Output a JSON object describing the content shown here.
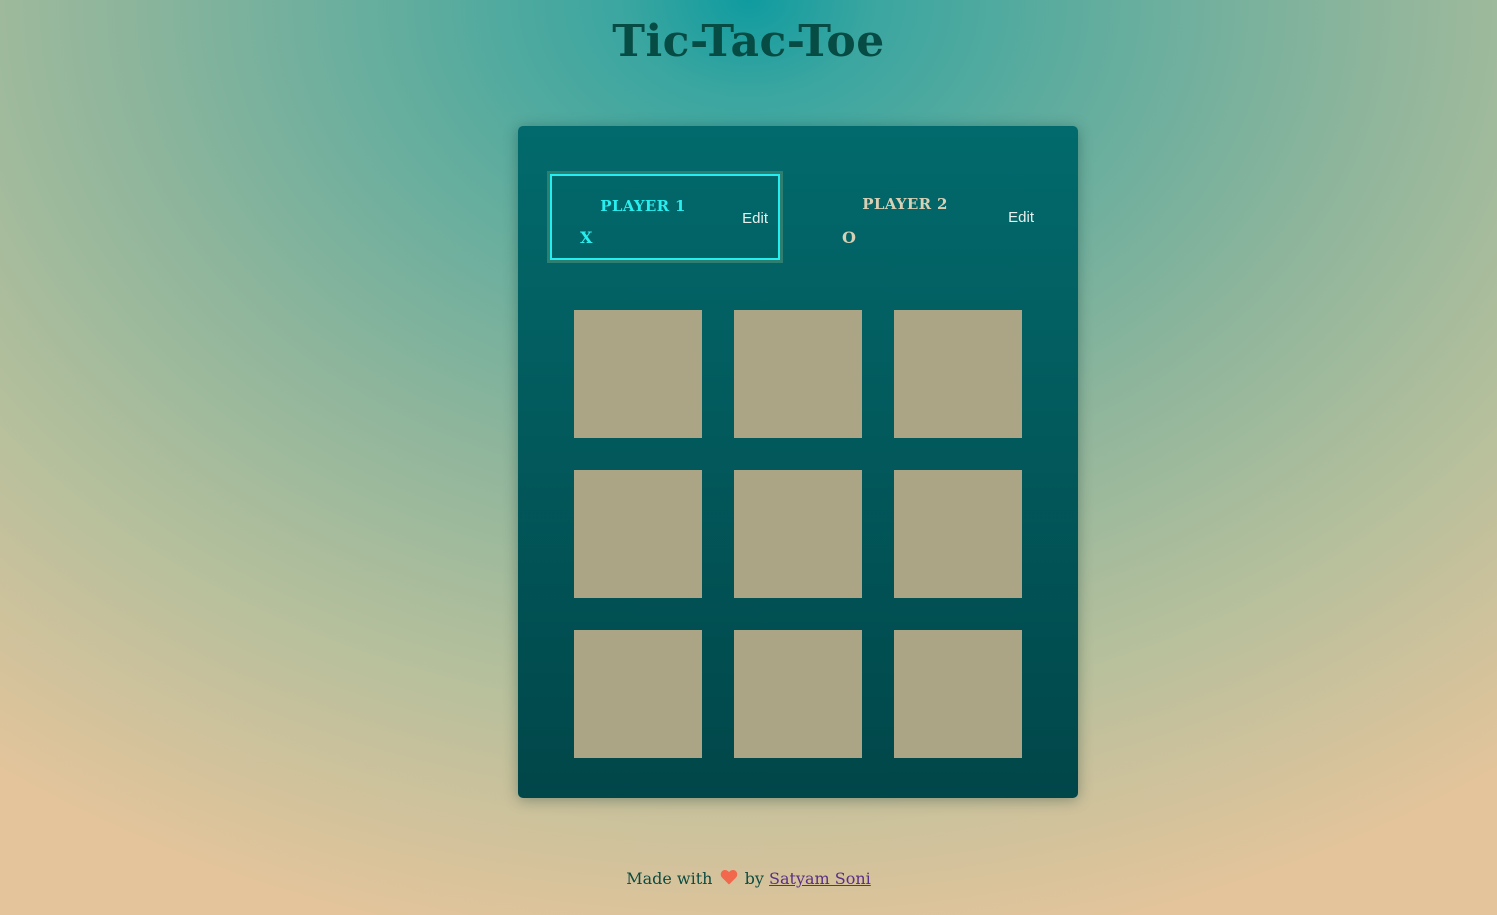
{
  "title": "Tic-Tac-Toe",
  "players": [
    {
      "name": "PLAYER 1",
      "symbol": "X",
      "edit_label": "Edit",
      "active": true
    },
    {
      "name": "PLAYER 2",
      "symbol": "O",
      "edit_label": "Edit",
      "active": false
    }
  ],
  "board": {
    "cells": [
      "",
      "",
      "",
      "",
      "",
      "",
      "",
      "",
      ""
    ]
  },
  "footer": {
    "prefix": "Made with",
    "icon": "heart-icon",
    "middle": "by",
    "author": "Satyam Soni"
  },
  "colors": {
    "active_player": "#29eef0",
    "inactive_player": "#d8d0b4",
    "cell": "#aba586",
    "heart": "#f2684d",
    "link": "#5a2d86"
  }
}
